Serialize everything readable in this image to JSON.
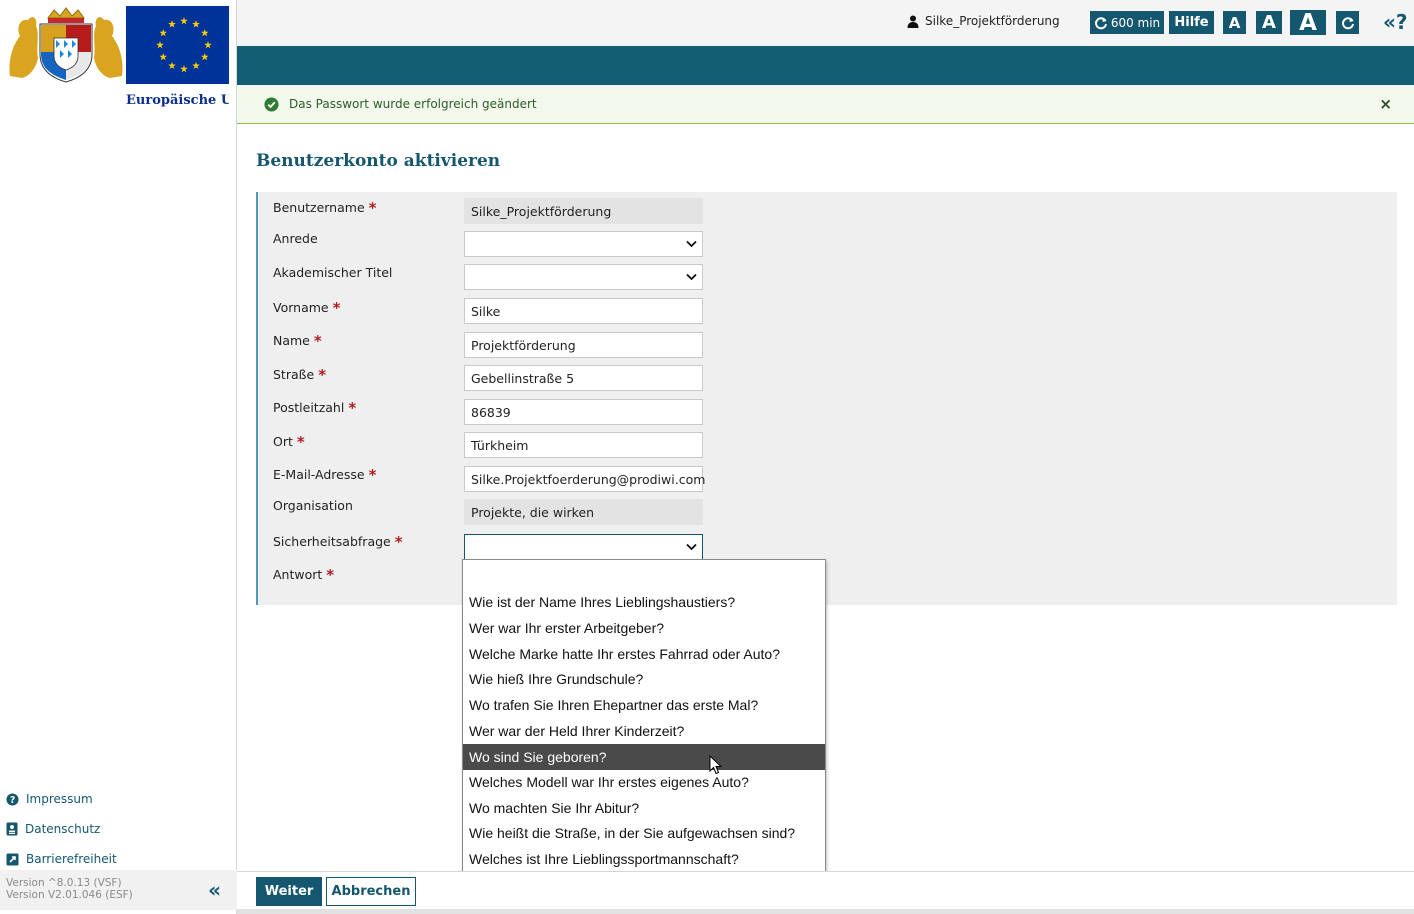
{
  "sidebar": {
    "eu_label": "Europäische Union",
    "links": [
      {
        "label": "Impressum",
        "icon": "question-circle-icon"
      },
      {
        "label": "Datenschutz",
        "icon": "badge-icon"
      },
      {
        "label": "Barrierefreiheit",
        "icon": "external-link-icon"
      }
    ],
    "version_lines": [
      "Version ^8.0.13 (VSF)",
      "Version V2.01.046 (ESF)"
    ],
    "collapse_label": "«"
  },
  "header": {
    "username": "Silke_Projektförderung",
    "session_timer": "600 min",
    "help_label": "Hilfe",
    "font_small": "A",
    "font_medium": "A",
    "font_large": "A",
    "help_toggle": "«?"
  },
  "notice": {
    "text": "Das Passwort wurde erfolgreich geändert",
    "close": "×"
  },
  "page": {
    "title": "Benutzerkonto aktivieren"
  },
  "form": {
    "required_mark": "*",
    "fields": [
      {
        "label": "Benutzername",
        "value": "Silke_Projektförderung",
        "required": true,
        "kind": "readonly"
      },
      {
        "label": "Anrede",
        "value": "",
        "required": false,
        "kind": "select"
      },
      {
        "label": "Akademischer Titel",
        "value": "",
        "required": false,
        "kind": "select"
      },
      {
        "label": "Vorname",
        "value": "Silke",
        "required": true,
        "kind": "input"
      },
      {
        "label": "Name",
        "value": "Projektförderung",
        "required": true,
        "kind": "input"
      },
      {
        "label": "Straße",
        "value": "Gebellinstraße 5",
        "required": true,
        "kind": "input"
      },
      {
        "label": "Postleitzahl",
        "value": "86839",
        "required": true,
        "kind": "input"
      },
      {
        "label": "Ort",
        "value": "Türkheim",
        "required": true,
        "kind": "input"
      },
      {
        "label": "E-Mail-Adresse",
        "value": "Silke.Projektfoerderung@prodiwi.com",
        "required": true,
        "kind": "input"
      },
      {
        "label": "Organisation",
        "value": "Projekte, die wirken",
        "required": false,
        "kind": "readonly"
      },
      {
        "label": "Sicherheitsabfrage",
        "value": "",
        "required": true,
        "kind": "select-focus"
      },
      {
        "label": "Antwort",
        "value": "",
        "required": true,
        "kind": "hidden"
      }
    ]
  },
  "security_dropdown": {
    "options": [
      "",
      "Wie ist der Name Ihres Lieblingshaustiers?",
      "Wer war Ihr erster Arbeitgeber?",
      "Welche Marke hatte Ihr erstes Fahrrad oder Auto?",
      "Wie hieß Ihre Grundschule?",
      "Wo trafen Sie Ihren Ehepartner das erste Mal?",
      "Wer war der Held Ihrer Kinderzeit?",
      "Wo sind Sie geboren?",
      "Welches Modell war Ihr erstes eigenes Auto?",
      "Wo machten Sie Ihr Abitur?",
      "Wie heißt die Straße, in der Sie aufgewachsen sind?",
      "Welches ist Ihre Lieblingssportmannschaft?"
    ],
    "highlighted": "Wo sind Sie geboren?"
  },
  "actions": {
    "next_label": "Weiter",
    "cancel_label": "Abbrechen"
  },
  "colors": {
    "primary": "#15576e",
    "band": "#135e70",
    "required": "#b21d1d",
    "success_border": "#8bc34a"
  }
}
